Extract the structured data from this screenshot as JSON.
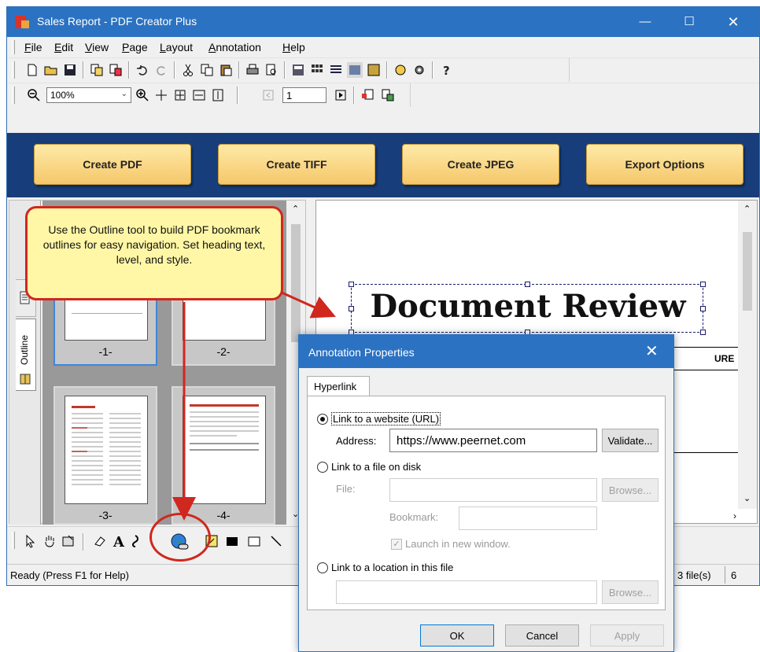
{
  "window": {
    "title": "Sales Report - PDF Creator Plus",
    "minimize": "—",
    "maximize": "☐",
    "close": "✕"
  },
  "menu": [
    {
      "first": "F",
      "rest": "ile"
    },
    {
      "first": "E",
      "rest": "dit"
    },
    {
      "first": "V",
      "rest": "iew"
    },
    {
      "first": "P",
      "rest": "age"
    },
    {
      "first": "L",
      "rest": "ayout"
    },
    {
      "first": "A",
      "rest": "nnotation"
    },
    {
      "first": "H",
      "rest": "elp"
    }
  ],
  "toolbar2": {
    "zoom_value": "100%",
    "page_value": "1"
  },
  "actions": {
    "create_pdf": "Create PDF",
    "create_tiff": "Create TIFF",
    "create_jpeg": "Create JPEG",
    "export_options": "Export Options"
  },
  "left_panel": {
    "outline_tab": "Outline",
    "thumbs": [
      "-1-",
      "-2-",
      "-3-",
      "-4-"
    ]
  },
  "document": {
    "title": "Document Review",
    "signature_header": "URE"
  },
  "status": {
    "text": "Ready (Press F1 for Help)",
    "files": "3 file(s)",
    "count": "6"
  },
  "callout": {
    "text": "Use the Outline tool to build PDF bookmark outlines for easy navigation. Set heading text, level, and style."
  },
  "dialog": {
    "title": "Annotation Properties",
    "close": "✕",
    "tab": "Hyperlink",
    "option_url": "Link to a website (URL)",
    "address_label": "Address:",
    "address_value": "https://www.peernet.com",
    "validate": "Validate...",
    "option_file": "Link to a file on disk",
    "file_label": "File:",
    "browse": "Browse...",
    "bookmark_label": "Bookmark:",
    "launch_new_window": "Launch in new window.",
    "option_location": "Link to a location in this file",
    "ok": "OK",
    "cancel": "Cancel",
    "apply": "Apply"
  },
  "colors": {
    "titlebar": "#2b72c2",
    "action_band": "#173e7a",
    "callout_border": "#d0271e",
    "callout_fill": "#fff7a6"
  }
}
